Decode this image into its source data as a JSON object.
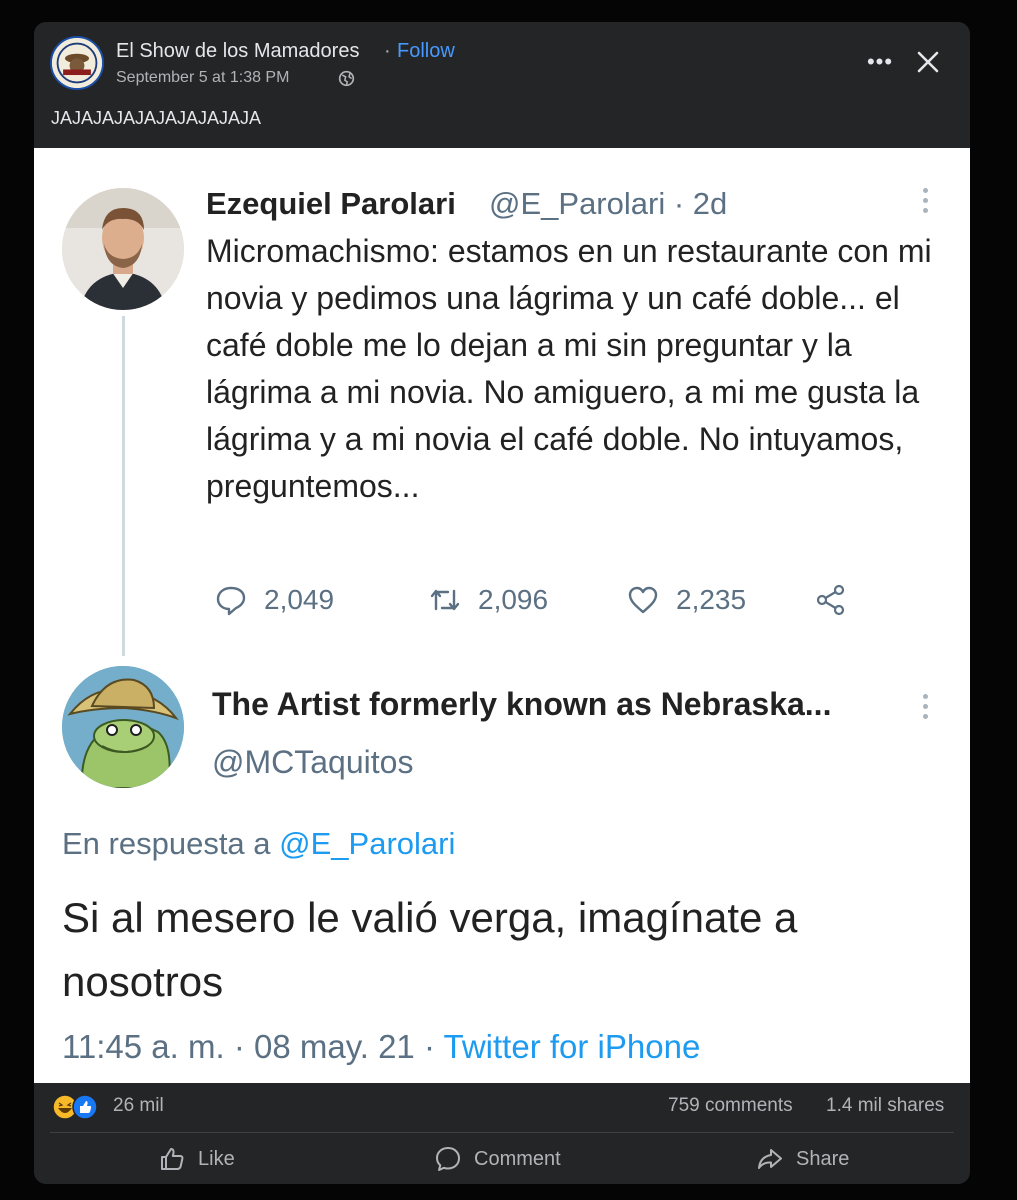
{
  "post": {
    "page_name": "El Show de los Mamadores",
    "separator": "·",
    "follow_label": "Follow",
    "timestamp": "September 5 at 1:38 PM",
    "caption": "JAJAJAJAJAJAJAJAJAJA",
    "more_label": "•••"
  },
  "tweet": {
    "author_name": "Ezequiel Parolari",
    "author_meta": "@E_Parolari · 2d",
    "body": "Micromachismo: estamos en un restaurante con mi novia y pedimos una lágrima y un café doble... el café doble me lo dejan a mi sin preguntar y la lágrima a mi novia. No amiguero, a mi me gusta la lágrima y a mi novia el café doble. No intuyamos, preguntemos...",
    "replies": "2,049",
    "retweets": "2,096",
    "likes": "2,235"
  },
  "reply": {
    "author_name": "The Artist formerly known as Nebraska...",
    "author_handle": "@MCTaquitos",
    "reply_prefix": "En respuesta a",
    "reply_mention": "@E_Parolari",
    "body": "Si al mesero le valió verga, imagínate a nosotros",
    "time_date": "11:45 a. m. · 08 may. 21 · ",
    "source": "Twitter for iPhone"
  },
  "stats": {
    "reactions": "26 mil",
    "comments": "759 comments",
    "shares": "1.4 mil shares"
  },
  "buttons": {
    "like": "Like",
    "comment": "Comment",
    "share": "Share"
  }
}
